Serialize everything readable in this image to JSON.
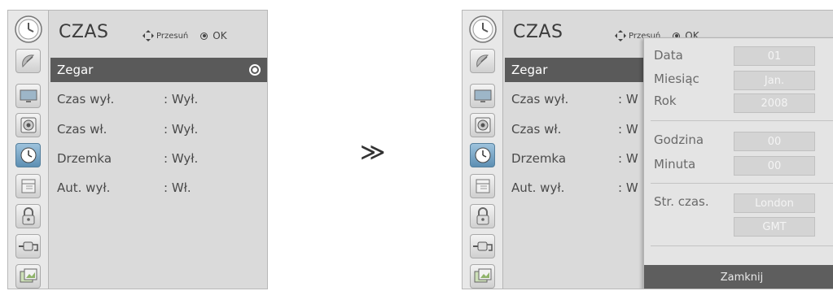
{
  "left_menu": {
    "title": "CZAS",
    "hint_move": "Przesuń",
    "hint_ok": "OK",
    "selected_item": "Zegar",
    "items": [
      {
        "label": "Zegar",
        "value": ""
      },
      {
        "label": "Czas wył.",
        "value": ": Wył."
      },
      {
        "label": "Czas wł.",
        "value": ": Wył."
      },
      {
        "label": "Drzemka",
        "value": ": Wył."
      },
      {
        "label": "Aut. wył.",
        "value": ": Wł."
      }
    ],
    "icons": [
      "clock-icon",
      "satellite-dish-icon",
      "tv-screen-icon",
      "speaker-icon",
      "clock-icon",
      "calendar-icon",
      "padlock-icon",
      "plug-icon",
      "photo-icon"
    ],
    "active_icon": "clock-icon"
  },
  "transition_symbol": "≫",
  "right_menu": {
    "title": "CZAS",
    "hint_move": "Przesuń",
    "hint_ok": "OK",
    "items": [
      {
        "label": "Zegar",
        "value": ""
      },
      {
        "label": "Czas wył.",
        "value": ": W"
      },
      {
        "label": "Czas wł.",
        "value": ": W"
      },
      {
        "label": "Drzemka",
        "value": ": W"
      },
      {
        "label": "Aut. wył.",
        "value": ": W"
      }
    ],
    "clock_panel": {
      "date_label": "Data",
      "date_value": "01",
      "month_label": "Miesiąc",
      "month_value": "Jan.",
      "year_label": "Rok",
      "year_value": "2008",
      "hour_label": "Godzina",
      "hour_value": "00",
      "minute_label": "Minuta",
      "minute_value": "00",
      "timezone_label": "Str. czas.",
      "timezone_city": "London",
      "timezone_offset": "GMT",
      "close_label": "Zamknij"
    }
  },
  "colors": {
    "menu_bg": "#dadada",
    "selected_row": "#5a5a5a",
    "panel_bg": "#e4e4e4",
    "field_bg": "#d4d4d4",
    "close_button": "#5e5e5e",
    "active_icon": "#6f9cbf"
  }
}
